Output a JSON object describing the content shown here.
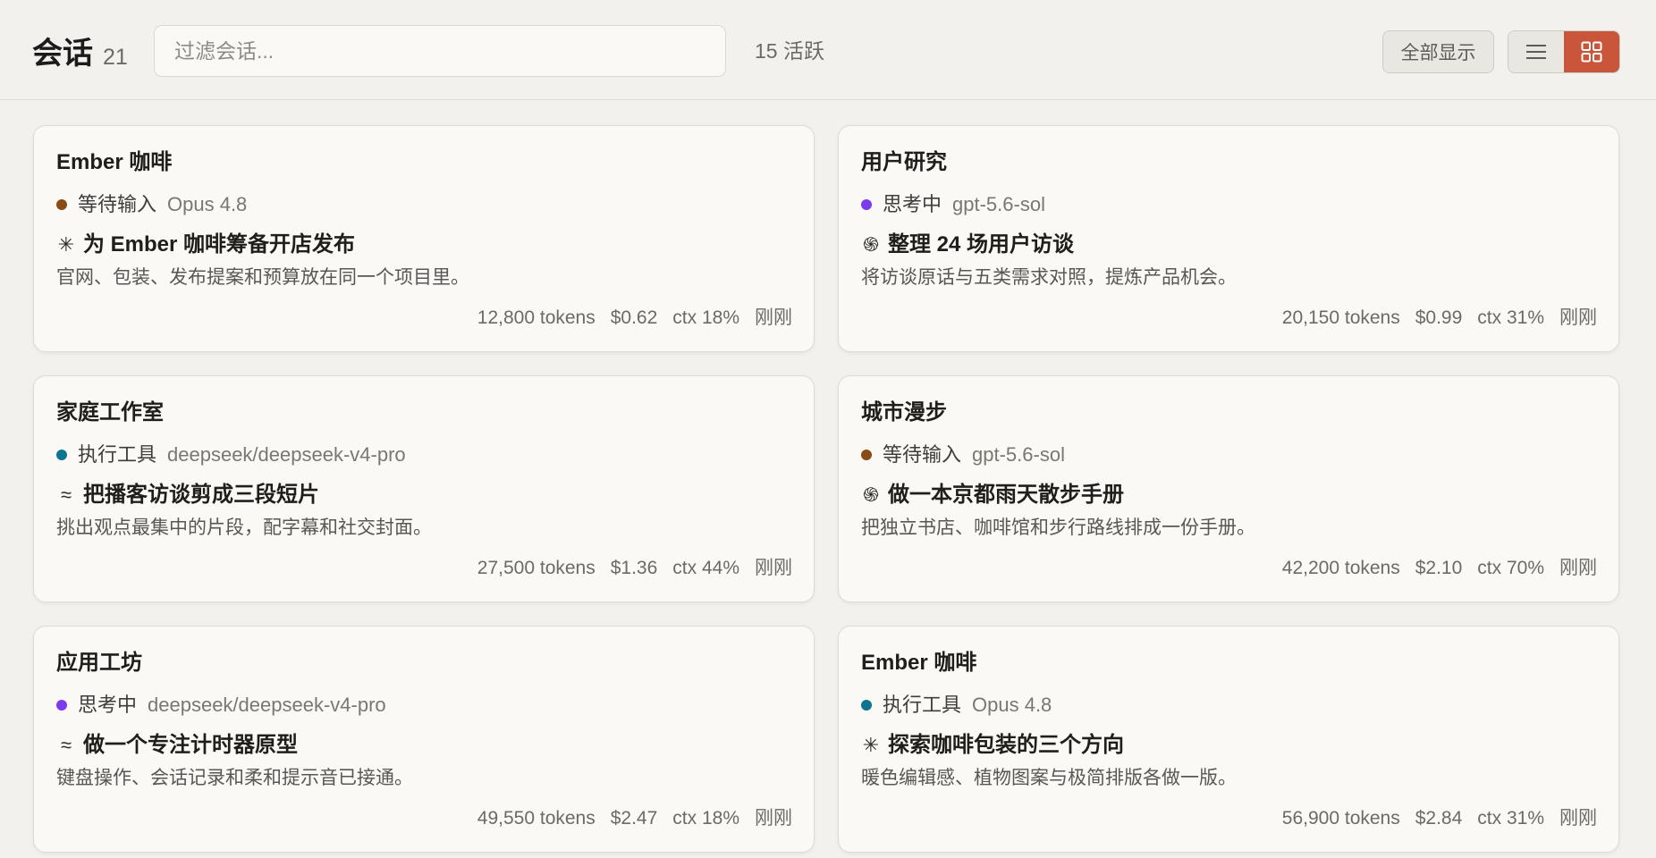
{
  "header": {
    "title": "会话",
    "count": "21",
    "filter_placeholder": "过滤会话...",
    "active_count": "15 活跃",
    "show_all_label": "全部显示",
    "list_view_icon": "list-icon",
    "grid_view_icon": "grid-icon",
    "accent_color": "#c9563a"
  },
  "status_colors": {
    "等待输入": "#8a4b14",
    "思考中": "#7c3aed",
    "执行工具": "#0e7490"
  },
  "cards": [
    {
      "name": "Ember 咖啡",
      "status": "等待输入",
      "model": "Opus 4.8",
      "task_icon": "claude-icon",
      "task_glyph": "✳",
      "task": "为 Ember 咖啡筹备开店发布",
      "description": "官网、包装、发布提案和预算放在同一个项目里。",
      "tokens": "12,800 tokens",
      "cost": "$0.62",
      "ctx": "ctx 18%",
      "time": "刚刚"
    },
    {
      "name": "用户研究",
      "status": "思考中",
      "model": "gpt-5.6-sol",
      "task_icon": "openai-icon",
      "task_glyph": "֍",
      "task": "整理 24 场用户访谈",
      "description": "将访谈原话与五类需求对照，提炼产品机会。",
      "tokens": "20,150 tokens",
      "cost": "$0.99",
      "ctx": "ctx 31%",
      "time": "刚刚"
    },
    {
      "name": "家庭工作室",
      "status": "执行工具",
      "model": "deepseek/deepseek-v4-pro",
      "task_icon": "deepseek-whale-icon",
      "task_glyph": "≈",
      "task": "把播客访谈剪成三段短片",
      "description": "挑出观点最集中的片段，配字幕和社交封面。",
      "tokens": "27,500 tokens",
      "cost": "$1.36",
      "ctx": "ctx 44%",
      "time": "刚刚"
    },
    {
      "name": "城市漫步",
      "status": "等待输入",
      "model": "gpt-5.6-sol",
      "task_icon": "openai-icon",
      "task_glyph": "֍",
      "task": "做一本京都雨天散步手册",
      "description": "把独立书店、咖啡馆和步行路线排成一份手册。",
      "tokens": "42,200 tokens",
      "cost": "$2.10",
      "ctx": "ctx 70%",
      "time": "刚刚"
    },
    {
      "name": "应用工坊",
      "status": "思考中",
      "model": "deepseek/deepseek-v4-pro",
      "task_icon": "deepseek-whale-icon",
      "task_glyph": "≈",
      "task": "做一个专注计时器原型",
      "description": "键盘操作、会话记录和柔和提示音已接通。",
      "tokens": "49,550 tokens",
      "cost": "$2.47",
      "ctx": "ctx 18%",
      "time": "刚刚"
    },
    {
      "name": "Ember 咖啡",
      "status": "执行工具",
      "model": "Opus 4.8",
      "task_icon": "claude-icon",
      "task_glyph": "✳",
      "task": "探索咖啡包装的三个方向",
      "description": "暖色编辑感、植物图案与极简排版各做一版。",
      "tokens": "56,900 tokens",
      "cost": "$2.84",
      "ctx": "ctx 31%",
      "time": "刚刚"
    }
  ]
}
